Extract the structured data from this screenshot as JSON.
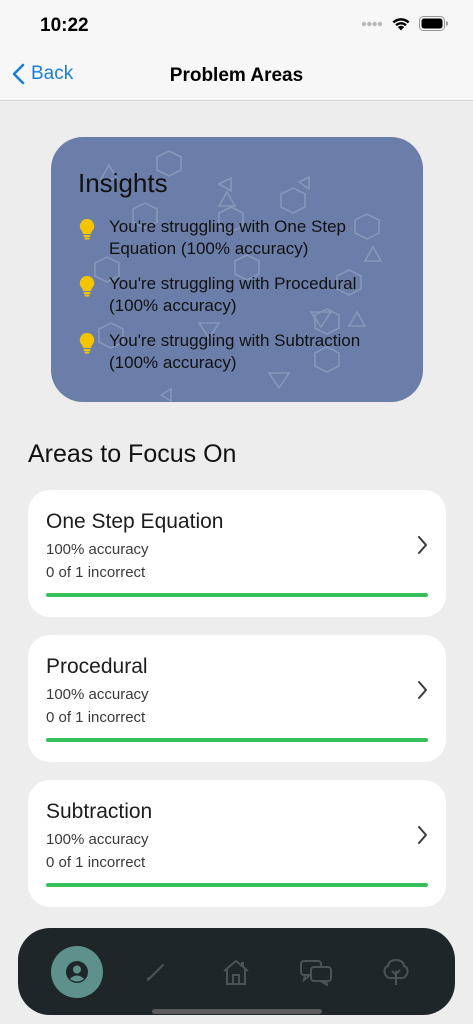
{
  "status_bar": {
    "time": "10:22",
    "icons": [
      "signal-dots-icon",
      "wifi-icon",
      "battery-icon"
    ]
  },
  "nav": {
    "back_label": "Back",
    "title": "Problem Areas"
  },
  "insights": {
    "title": "Insights",
    "items": [
      "You're struggling with One Step Equation (100% accuracy)",
      "You're struggling with Procedural (100% accuracy)",
      "You're struggling with Subtraction (100% accuracy)"
    ]
  },
  "focus": {
    "title": "Areas to Focus On",
    "items": [
      {
        "name": "One Step Equation",
        "accuracy": "100% accuracy",
        "incorrect": "0 of 1 incorrect",
        "progress": 1.0
      },
      {
        "name": "Procedural",
        "accuracy": "100% accuracy",
        "incorrect": "0 of 1 incorrect",
        "progress": 1.0
      },
      {
        "name": "Subtraction",
        "accuracy": "100% accuracy",
        "incorrect": "0 of 1 incorrect",
        "progress": 1.0
      }
    ]
  },
  "tabs": [
    {
      "icon": "profile-icon",
      "active": true
    },
    {
      "icon": "pencil-icon",
      "active": false
    },
    {
      "icon": "home-icon",
      "active": false
    },
    {
      "icon": "chat-bubbles-icon",
      "active": false
    },
    {
      "icon": "tree-icon",
      "active": false
    }
  ],
  "colors": {
    "accent": "#1a7fd4",
    "insights_bg": "#6b7ea9",
    "progress": "#34c05a",
    "tab_bar_bg": "#1f2629",
    "tab_active": "#5e918c",
    "bulb": "#f5c400"
  }
}
